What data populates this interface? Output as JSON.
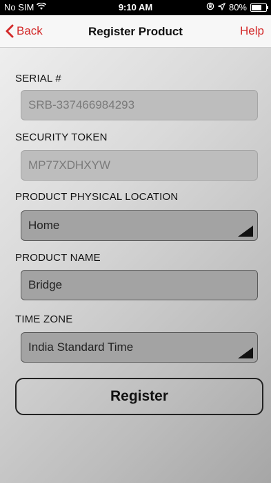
{
  "status": {
    "carrier": "No SIM",
    "time": "9:10 AM",
    "battery": "80%",
    "battery_level": 0.8
  },
  "nav": {
    "back_label": "Back",
    "title": "Register Product",
    "help_label": "Help"
  },
  "form": {
    "serial": {
      "label": "SERIAL #",
      "value": "SRB-337466984293"
    },
    "token": {
      "label": "SECURITY TOKEN",
      "value": "MP77XDHXYW"
    },
    "location": {
      "label": "PRODUCT PHYSICAL LOCATION",
      "value": "Home"
    },
    "name": {
      "label": "PRODUCT NAME",
      "value": "Bridge"
    },
    "timezone": {
      "label": "TIME ZONE",
      "value": "India Standard Time"
    }
  },
  "actions": {
    "register_label": "Register"
  },
  "colors": {
    "accent": "#d32a2a"
  }
}
